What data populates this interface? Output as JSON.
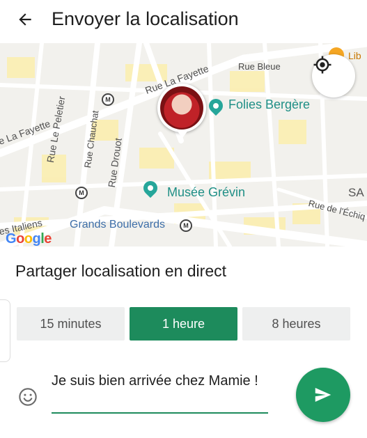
{
  "header": {
    "title": "Envoyer la localisation",
    "back_icon": "arrow-back-icon"
  },
  "map": {
    "streets": {
      "rue_la_fayette_top": "Rue La Fayette",
      "rue_bleue": "Rue Bleue",
      "rue_la_fayette_left": "e La Fayette",
      "rue_le_peletier": "Rue Le Peletier",
      "rue_chauchat": "Rue Chauchat",
      "rue_drouot": "Rue Drouot",
      "bd_italiens": "es Italiens",
      "rue_echiquier": "Rue de l'Échiq",
      "sa": "SA"
    },
    "pois": {
      "folies": "Folies Bergère",
      "grevin": "Musée Grévin",
      "grands_boulevards": "Grands Boulevards",
      "lib": "Lib"
    },
    "metro_symbol": "M",
    "google_letters": [
      "G",
      "o",
      "o",
      "g",
      "l",
      "e"
    ],
    "google_colors": [
      "#4285f4",
      "#ea4335",
      "#fbbc05",
      "#4285f4",
      "#34a853",
      "#ea4335"
    ],
    "accent": "#26a69a"
  },
  "live": {
    "title": "Partager localisation en direct",
    "options": [
      "15 minutes",
      "1 heure",
      "8 heures"
    ],
    "selected": "1 heure",
    "selected_color": "#1d8b5c"
  },
  "composer": {
    "message": "Je suis bien arrivée chez Mamie !",
    "emoji_icon": "emoji-smile-icon",
    "send_icon": "send-icon",
    "send_color": "#1e9a62"
  }
}
